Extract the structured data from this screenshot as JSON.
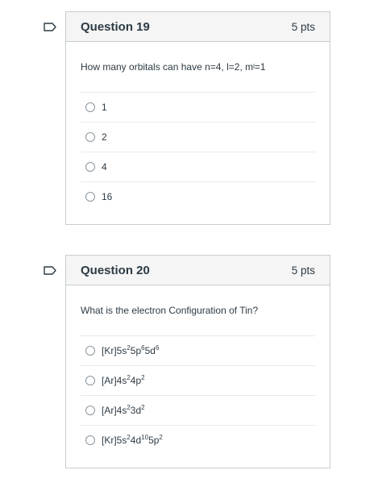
{
  "questions": [
    {
      "title": "Question 19",
      "points": "5 pts",
      "prompt": "How many orbitals can have n=4, l=2, m",
      "prompt_sub": "l",
      "prompt_tail": "=1",
      "answers": [
        "1",
        "2",
        "4",
        "16"
      ]
    },
    {
      "title": "Question 20",
      "points": "5 pts",
      "prompt": "What is the electron Configuration of Tin?",
      "answers": [
        {
          "parts": [
            "[Kr]5s",
            "2",
            "5p",
            "6",
            "5d",
            "6"
          ]
        },
        {
          "parts": [
            "[Ar]4s",
            "2",
            "4p",
            "2"
          ]
        },
        {
          "parts": [
            "[Ar]4s",
            "2",
            "3d",
            "2"
          ]
        },
        {
          "parts": [
            "[Kr]5s",
            "2",
            "4d",
            "10",
            "5p",
            "2"
          ]
        }
      ]
    }
  ],
  "icons": {
    "flag": "bookmark-flag-icon",
    "radio": "radio-button-icon"
  },
  "colors": {
    "border": "#c7cdd1",
    "header_bg": "#f5f5f5",
    "text": "#2d3b45",
    "flag": "#2d3b45"
  }
}
